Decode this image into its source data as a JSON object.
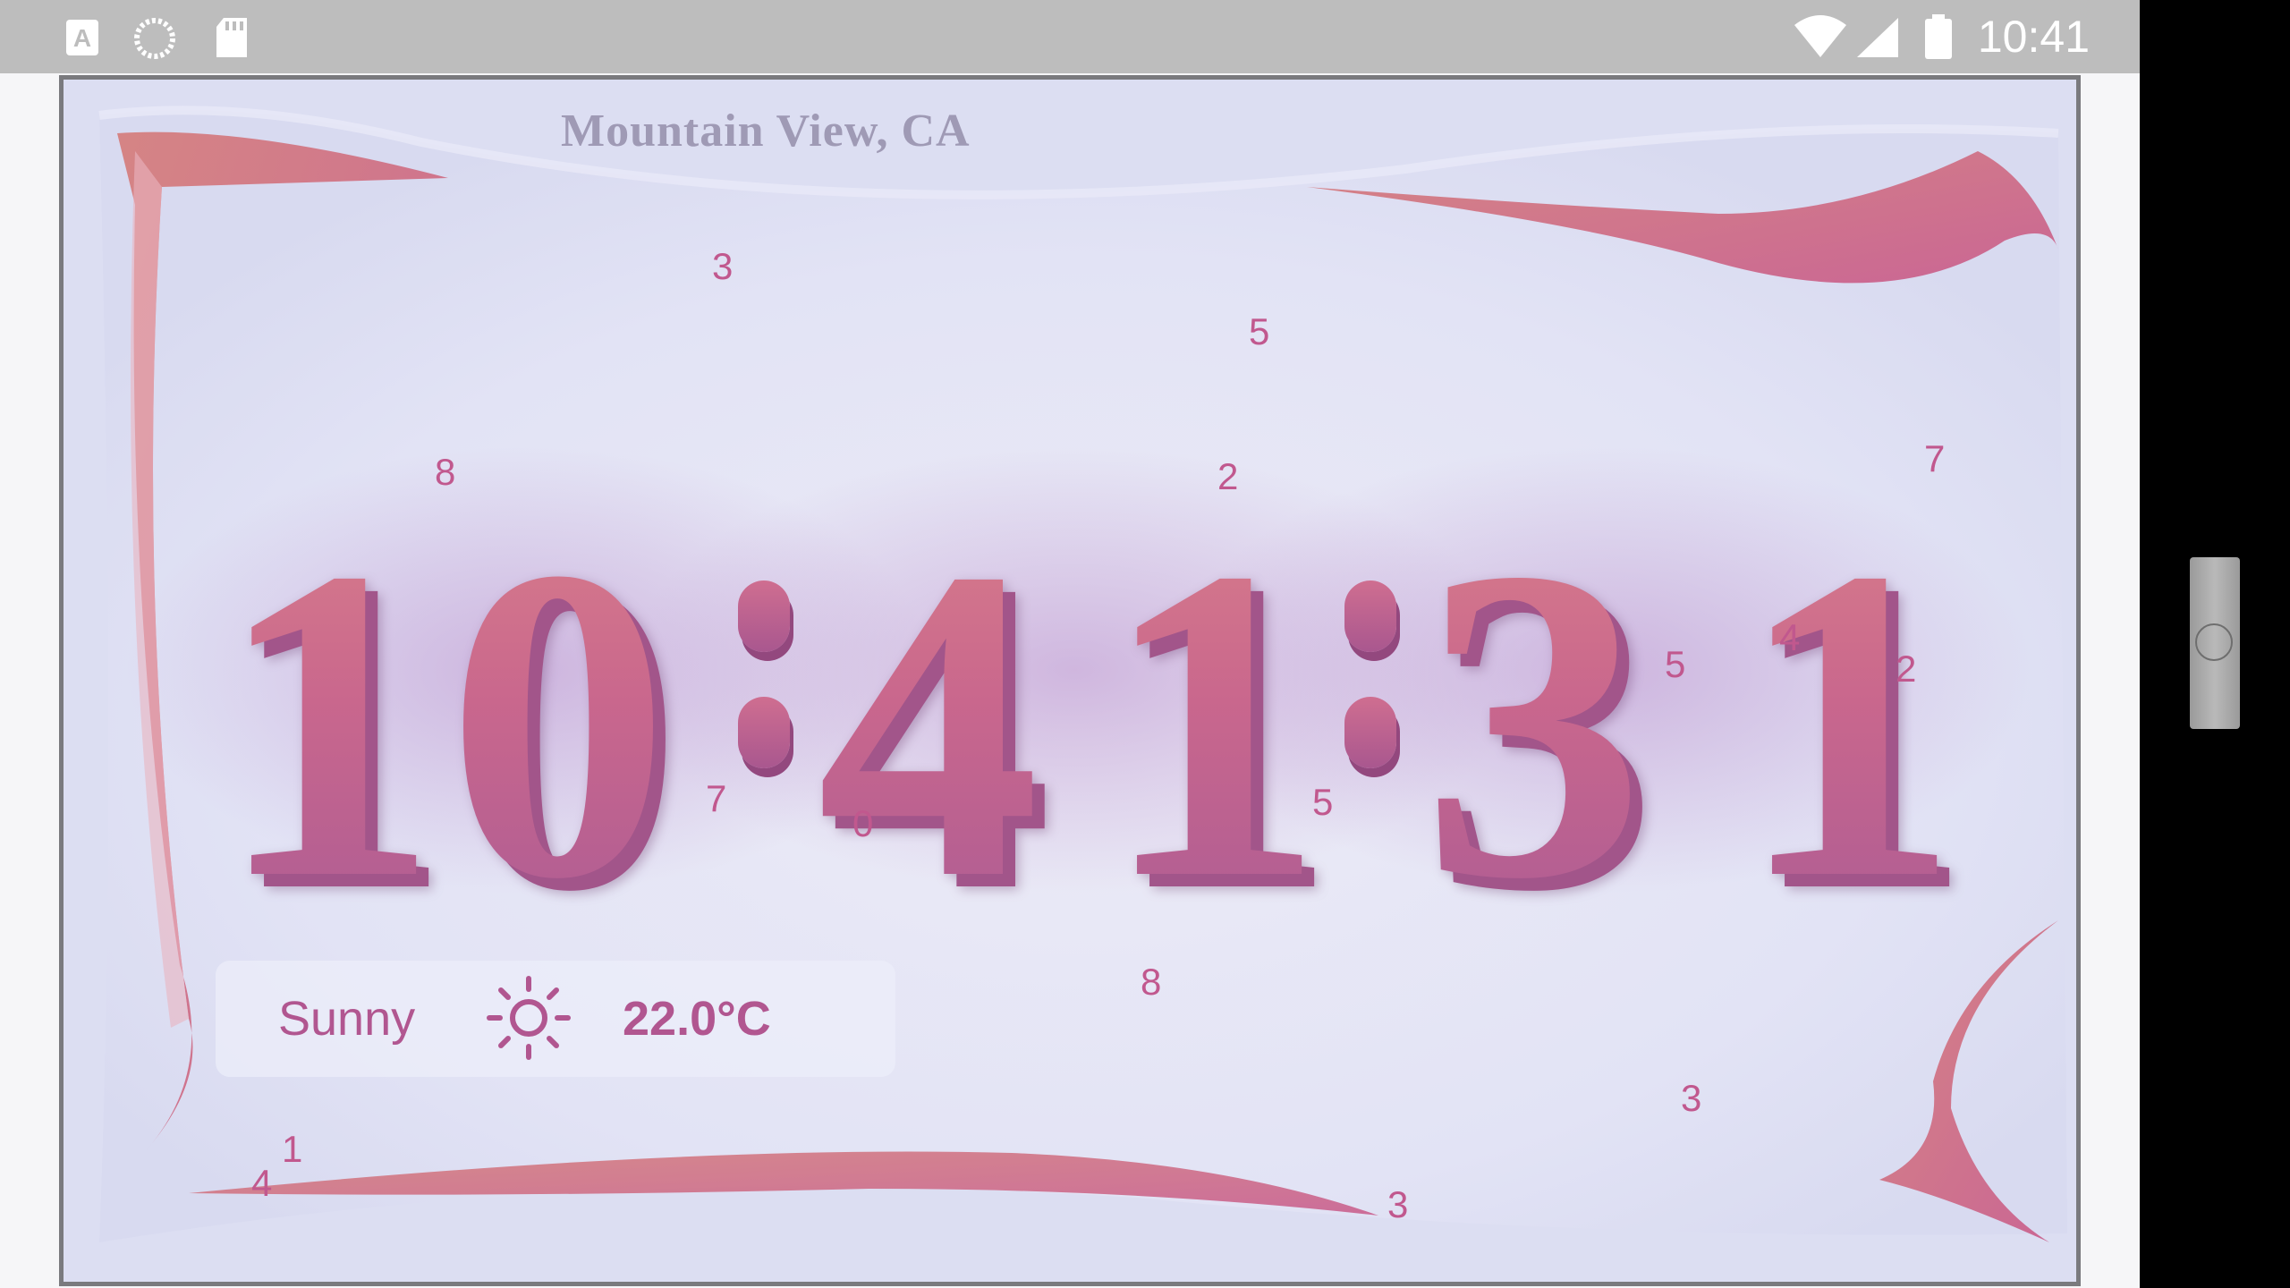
{
  "status_bar": {
    "time": "10:41",
    "icons": [
      "font-app-icon",
      "sync-icon",
      "sd-card-icon",
      "wifi-icon",
      "signal-icon",
      "battery-icon"
    ]
  },
  "clock": {
    "location": "Mountain View, CA",
    "time": "10:41:31",
    "hour_digits": [
      "1",
      "0"
    ],
    "minute_digits": [
      "4",
      "1"
    ],
    "second_digits": [
      "3",
      "1"
    ]
  },
  "weather": {
    "condition": "Sunny",
    "icon": "sun-icon",
    "temperature": "22.0°C"
  },
  "floating_numbers": [
    "3",
    "5",
    "8",
    "2",
    "7",
    "4",
    "5",
    "2",
    "7",
    "0",
    "5",
    "8",
    "3",
    "1",
    "4",
    "3"
  ],
  "colors": {
    "accent": "#c1588e",
    "background": "#dfe0f3",
    "ribbon": "#d07c88",
    "status_bar": "#bdbdbd"
  }
}
